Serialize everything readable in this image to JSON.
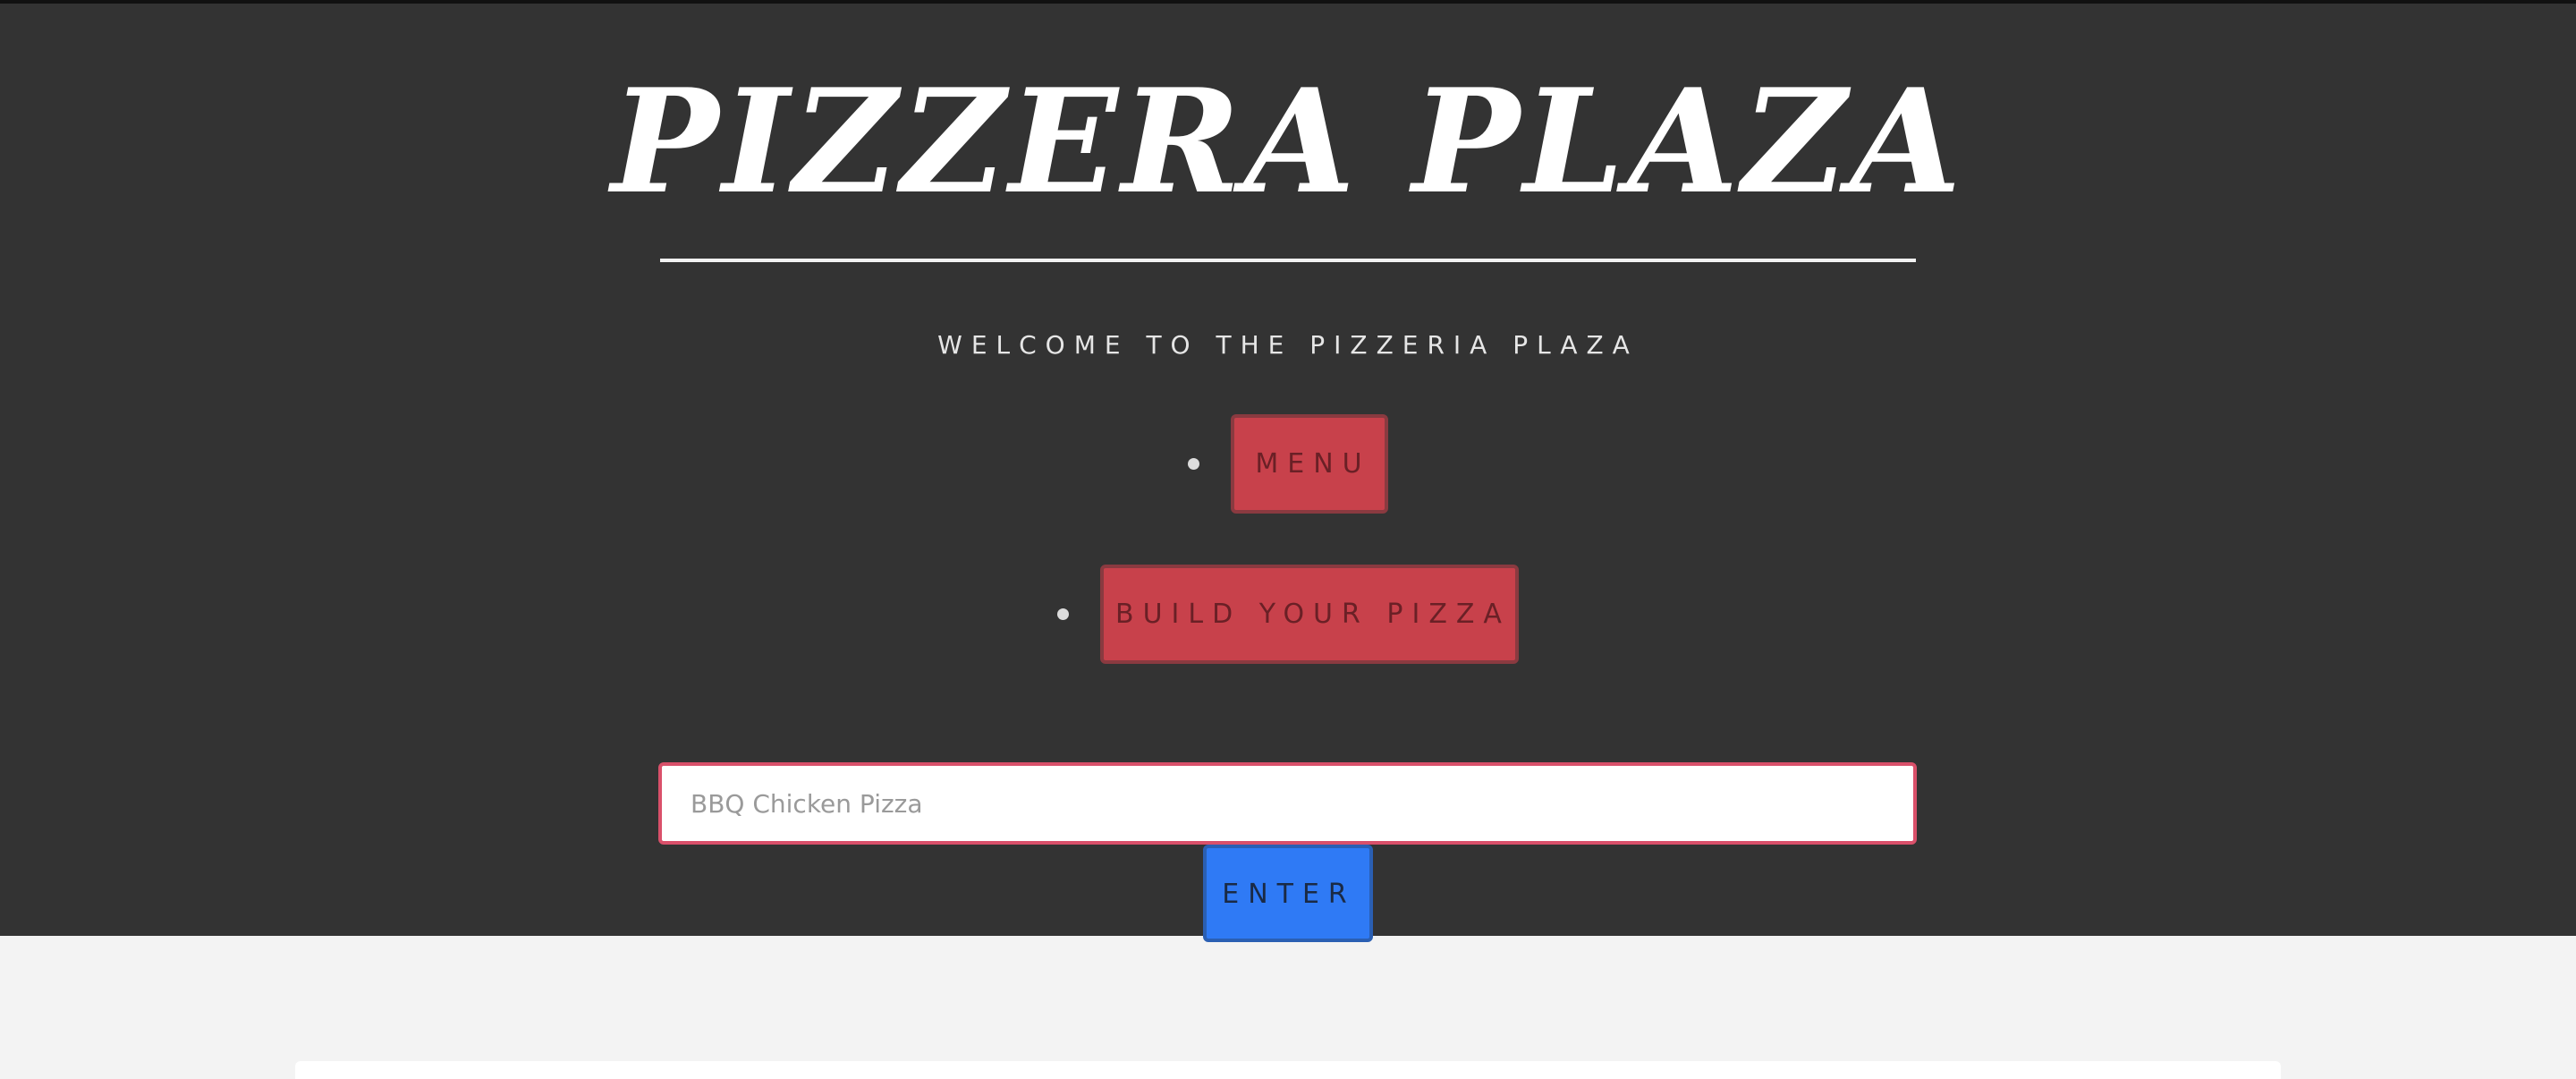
{
  "header": {
    "title": "PIZZERA PLAZA",
    "welcome": "WELCOME TO THE PIZZERIA PLAZA"
  },
  "nav": {
    "items": [
      {
        "label": "MENU"
      },
      {
        "label": "BUILD YOUR PIZZA"
      }
    ]
  },
  "search": {
    "placeholder": "BBQ Chicken Pizza",
    "value": "",
    "submit_label": "ENTER"
  },
  "colors": {
    "hero_background": "#333333",
    "page_background": "#f3f3f3",
    "nav_button": "#c8414b",
    "input_border": "#d9506a",
    "enter_button": "#2f7af5"
  }
}
